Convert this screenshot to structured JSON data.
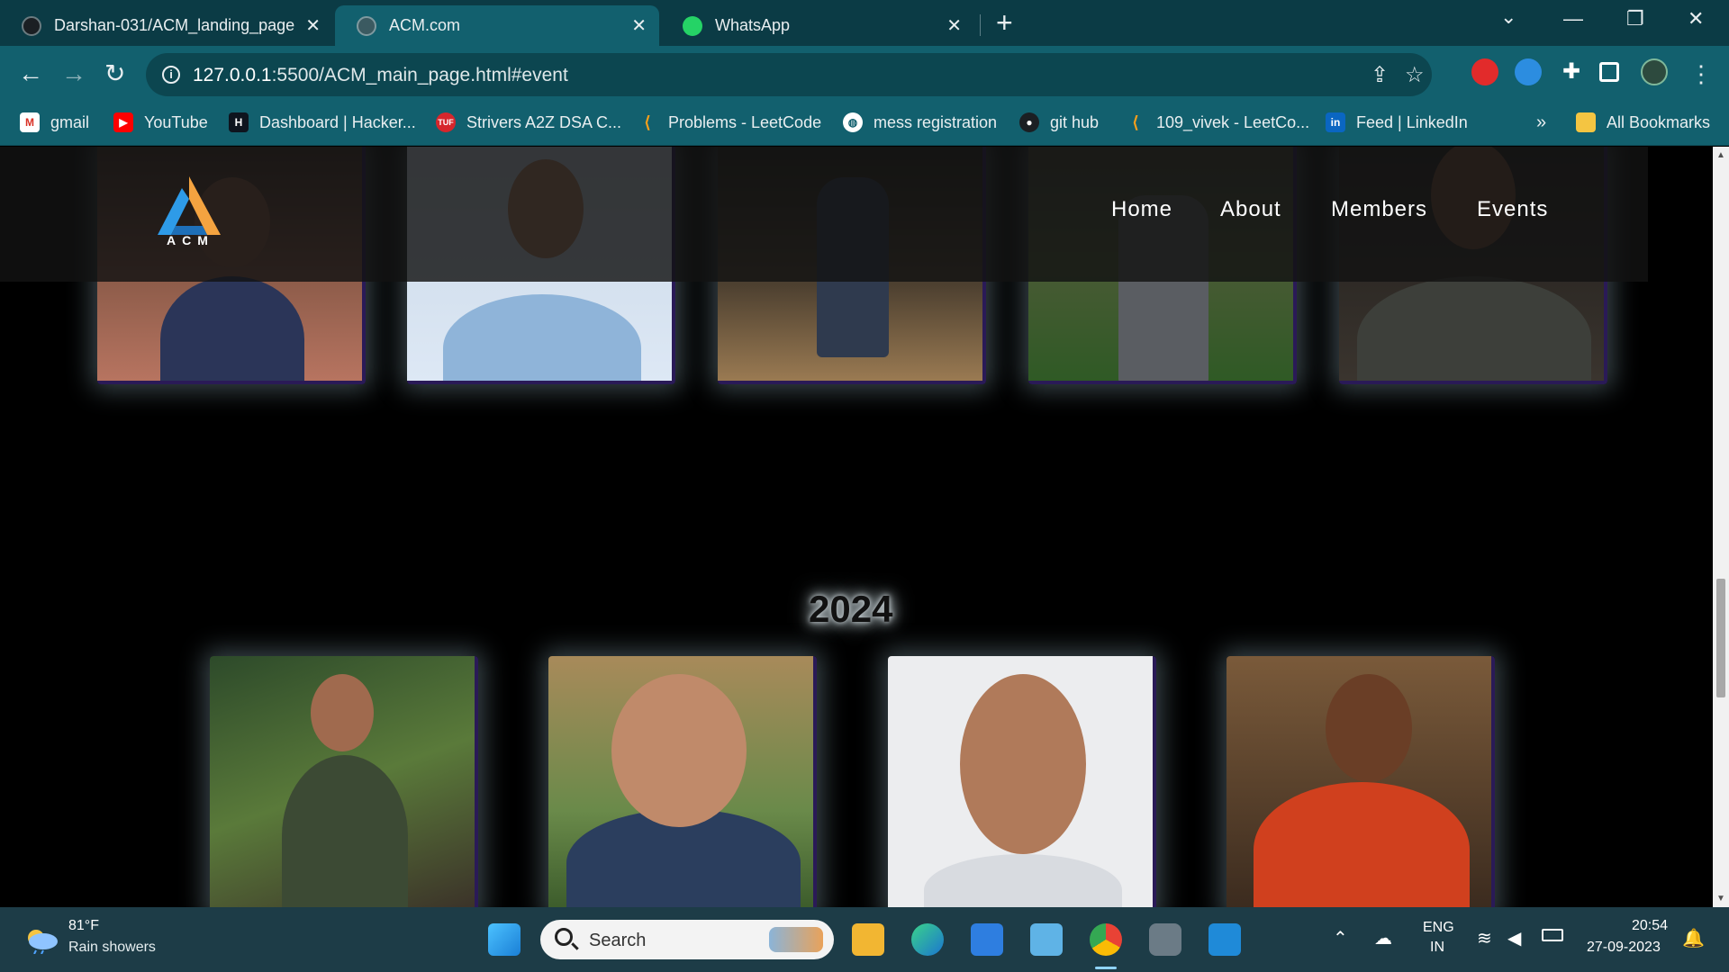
{
  "browser": {
    "tabs": [
      {
        "title": "Darshan-031/ACM_landing_page",
        "active": false
      },
      {
        "title": "ACM.com",
        "active": true
      },
      {
        "title": "WhatsApp",
        "active": false
      }
    ],
    "new_tab": "+",
    "address": {
      "host": "127.0.0.1",
      "path": ":5500/ACM_main_page.html#event"
    },
    "bookmarks": [
      {
        "label": "gmail",
        "icon": "gmail-icon"
      },
      {
        "label": "YouTube",
        "icon": "youtube-icon"
      },
      {
        "label": "Dashboard | Hacker...",
        "icon": "hackerrank-icon"
      },
      {
        "label": "Strivers A2Z DSA C...",
        "icon": "tuf-icon"
      },
      {
        "label": "Problems - LeetCode",
        "icon": "leetcode-icon"
      },
      {
        "label": "mess registration",
        "icon": "globe-icon"
      },
      {
        "label": "git hub",
        "icon": "github-icon"
      },
      {
        "label": "109_vivek - LeetCo...",
        "icon": "leetcode-icon"
      },
      {
        "label": "Feed | LinkedIn",
        "icon": "linkedin-icon"
      }
    ],
    "more_bookmarks": "»",
    "all_bookmarks": "All Bookmarks"
  },
  "page": {
    "logo_text": "ACM",
    "nav": [
      "Home",
      "About",
      "Members",
      "Events"
    ],
    "year": "2024"
  },
  "taskbar": {
    "weather_temp": "81°F",
    "weather_desc": "Rain showers",
    "search_placeholder": "Search",
    "lang_top": "ENG",
    "lang_bottom": "IN",
    "time": "20:54",
    "date": "27-09-2023"
  },
  "colors": {
    "tab_strip": "#0b3b45",
    "toolbar": "#12606e",
    "taskbar": "#1d3c47",
    "card_border": "#2a1a57"
  }
}
